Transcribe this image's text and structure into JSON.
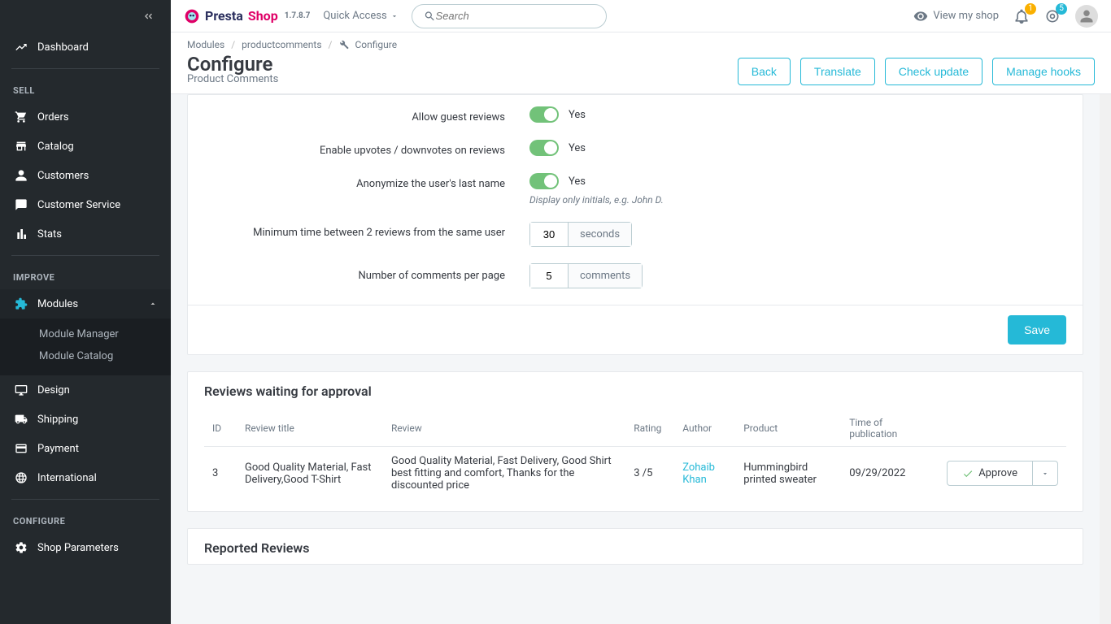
{
  "brand": {
    "p": "Presta",
    "s": "Shop",
    "version": "1.7.8.7"
  },
  "topbar": {
    "quick_access": "Quick Access",
    "search_placeholder": "Search",
    "view_shop": "View my shop",
    "badge_notif": "1",
    "badge_ring": "5"
  },
  "breadcrumb": {
    "a": "Modules",
    "b": "productcomments",
    "c": "Configure"
  },
  "page": {
    "title": "Configure",
    "subtitle": "Product Comments"
  },
  "actions": {
    "back": "Back",
    "translate": "Translate",
    "check_update": "Check update",
    "manage_hooks": "Manage hooks"
  },
  "sidebar": {
    "dashboard": "Dashboard",
    "sell": "SELL",
    "orders": "Orders",
    "catalog": "Catalog",
    "customers": "Customers",
    "cservice": "Customer Service",
    "stats": "Stats",
    "improve": "IMPROVE",
    "modules": "Modules",
    "module_manager": "Module Manager",
    "module_catalog": "Module Catalog",
    "design": "Design",
    "shipping": "Shipping",
    "payment": "Payment",
    "international": "International",
    "configure": "CONFIGURE",
    "shop_params": "Shop Parameters"
  },
  "form": {
    "allow_guest": "Allow guest reviews",
    "enable_votes": "Enable upvotes / downvotes on reviews",
    "anonymize": "Anonymize the user's last name",
    "anonymize_hint": "Display only initials, e.g. John D.",
    "min_time": "Minimum time between 2 reviews from the same user",
    "min_time_val": "30",
    "seconds": "seconds",
    "per_page": "Number of comments per page",
    "per_page_val": "5",
    "comments": "comments",
    "yes": "Yes",
    "save": "Save"
  },
  "pending": {
    "heading": "Reviews waiting for approval",
    "cols": {
      "id": "ID",
      "title": "Review title",
      "review": "Review",
      "rating": "Rating",
      "author": "Author",
      "product": "Product",
      "time": "Time of publication"
    },
    "row": {
      "id": "3",
      "title": "Good Quality Material, Fast Delivery,Good T-Shirt",
      "review": "Good Quality Material, Fast Delivery, Good Shirt best fitting and comfort, Thanks for the discounted price",
      "rating": "3 /5",
      "author": "Zohaib Khan",
      "product": "Hummingbird printed sweater",
      "time": "09/29/2022",
      "approve": "Approve"
    }
  },
  "reported": {
    "heading": "Reported Reviews"
  }
}
